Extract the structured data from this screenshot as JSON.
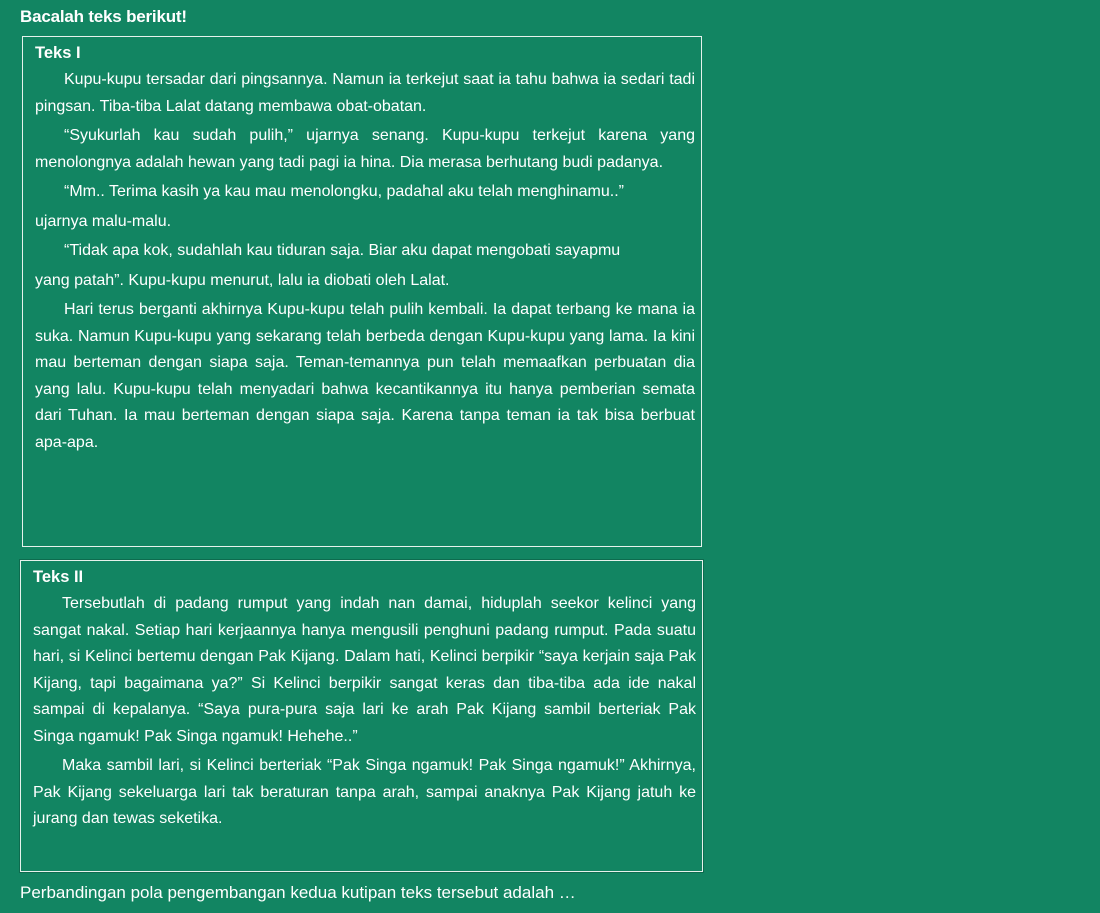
{
  "instruction": "Bacalah teks berikut!",
  "text1": {
    "title": "Teks I",
    "p1": "Kupu-kupu tersadar dari pingsannya. Namun ia terkejut saat ia tahu bahwa ia sedari tadi pingsan. Tiba-tiba Lalat datang membawa obat-obatan.",
    "p2": "“Syukurlah kau sudah pulih,” ujarnya senang. Kupu-kupu terkejut karena yang menolongnya adalah hewan yang tadi pagi ia hina. Dia merasa berhutang budi padanya.",
    "p3": "“Mm.. Terima kasih ya kau mau menolongku, padahal aku telah menghinamu..”",
    "p4": "ujarnya malu-malu.",
    "p5": "“Tidak apa kok, sudahlah kau tiduran saja. Biar aku dapat mengobati sayapmu",
    "p6": "yang patah”.  Kupu-kupu menurut, lalu ia diobati oleh Lalat.",
    "p7": "Hari terus berganti akhirnya Kupu-kupu telah pulih kembali. Ia dapat terbang ke mana ia suka. Namun Kupu-kupu yang sekarang telah berbeda dengan Kupu-kupu yang lama. Ia kini mau berteman dengan siapa saja. Teman-temannya pun telah memaafkan perbuatan dia yang lalu. Kupu-kupu telah menyadari bahwa kecantikannya itu hanya pemberian semata dari Tuhan. Ia mau berteman dengan siapa saja. Karena tanpa teman ia tak bisa berbuat apa-apa."
  },
  "text2": {
    "title": "Teks II",
    "p1": "Tersebutlah di padang rumput yang indah nan damai, hiduplah seekor kelinci yang sangat nakal. Setiap hari kerjaannya hanya mengusili penghuni padang rumput. Pada suatu hari, si Kelinci bertemu dengan Pak Kijang. Dalam hati, Kelinci berpikir “saya kerjain saja Pak Kijang, tapi bagaimana ya?” Si Kelinci berpikir sangat keras dan tiba-tiba ada ide nakal sampai di kepalanya. “Saya pura-pura saja lari  ke arah Pak Kijang sambil berteriak Pak Singa ngamuk! Pak Singa ngamuk! Hehehe..”",
    "p2": "Maka sambil lari, si Kelinci berteriak “Pak Singa ngamuk! Pak Singa ngamuk!” Akhirnya, Pak Kijang sekeluarga lari tak beraturan tanpa arah, sampai anaknya Pak Kijang jatuh ke jurang dan tewas seketika."
  },
  "question": "Perbandingan pola pengembangan kedua kutipan teks tersebut adalah …"
}
